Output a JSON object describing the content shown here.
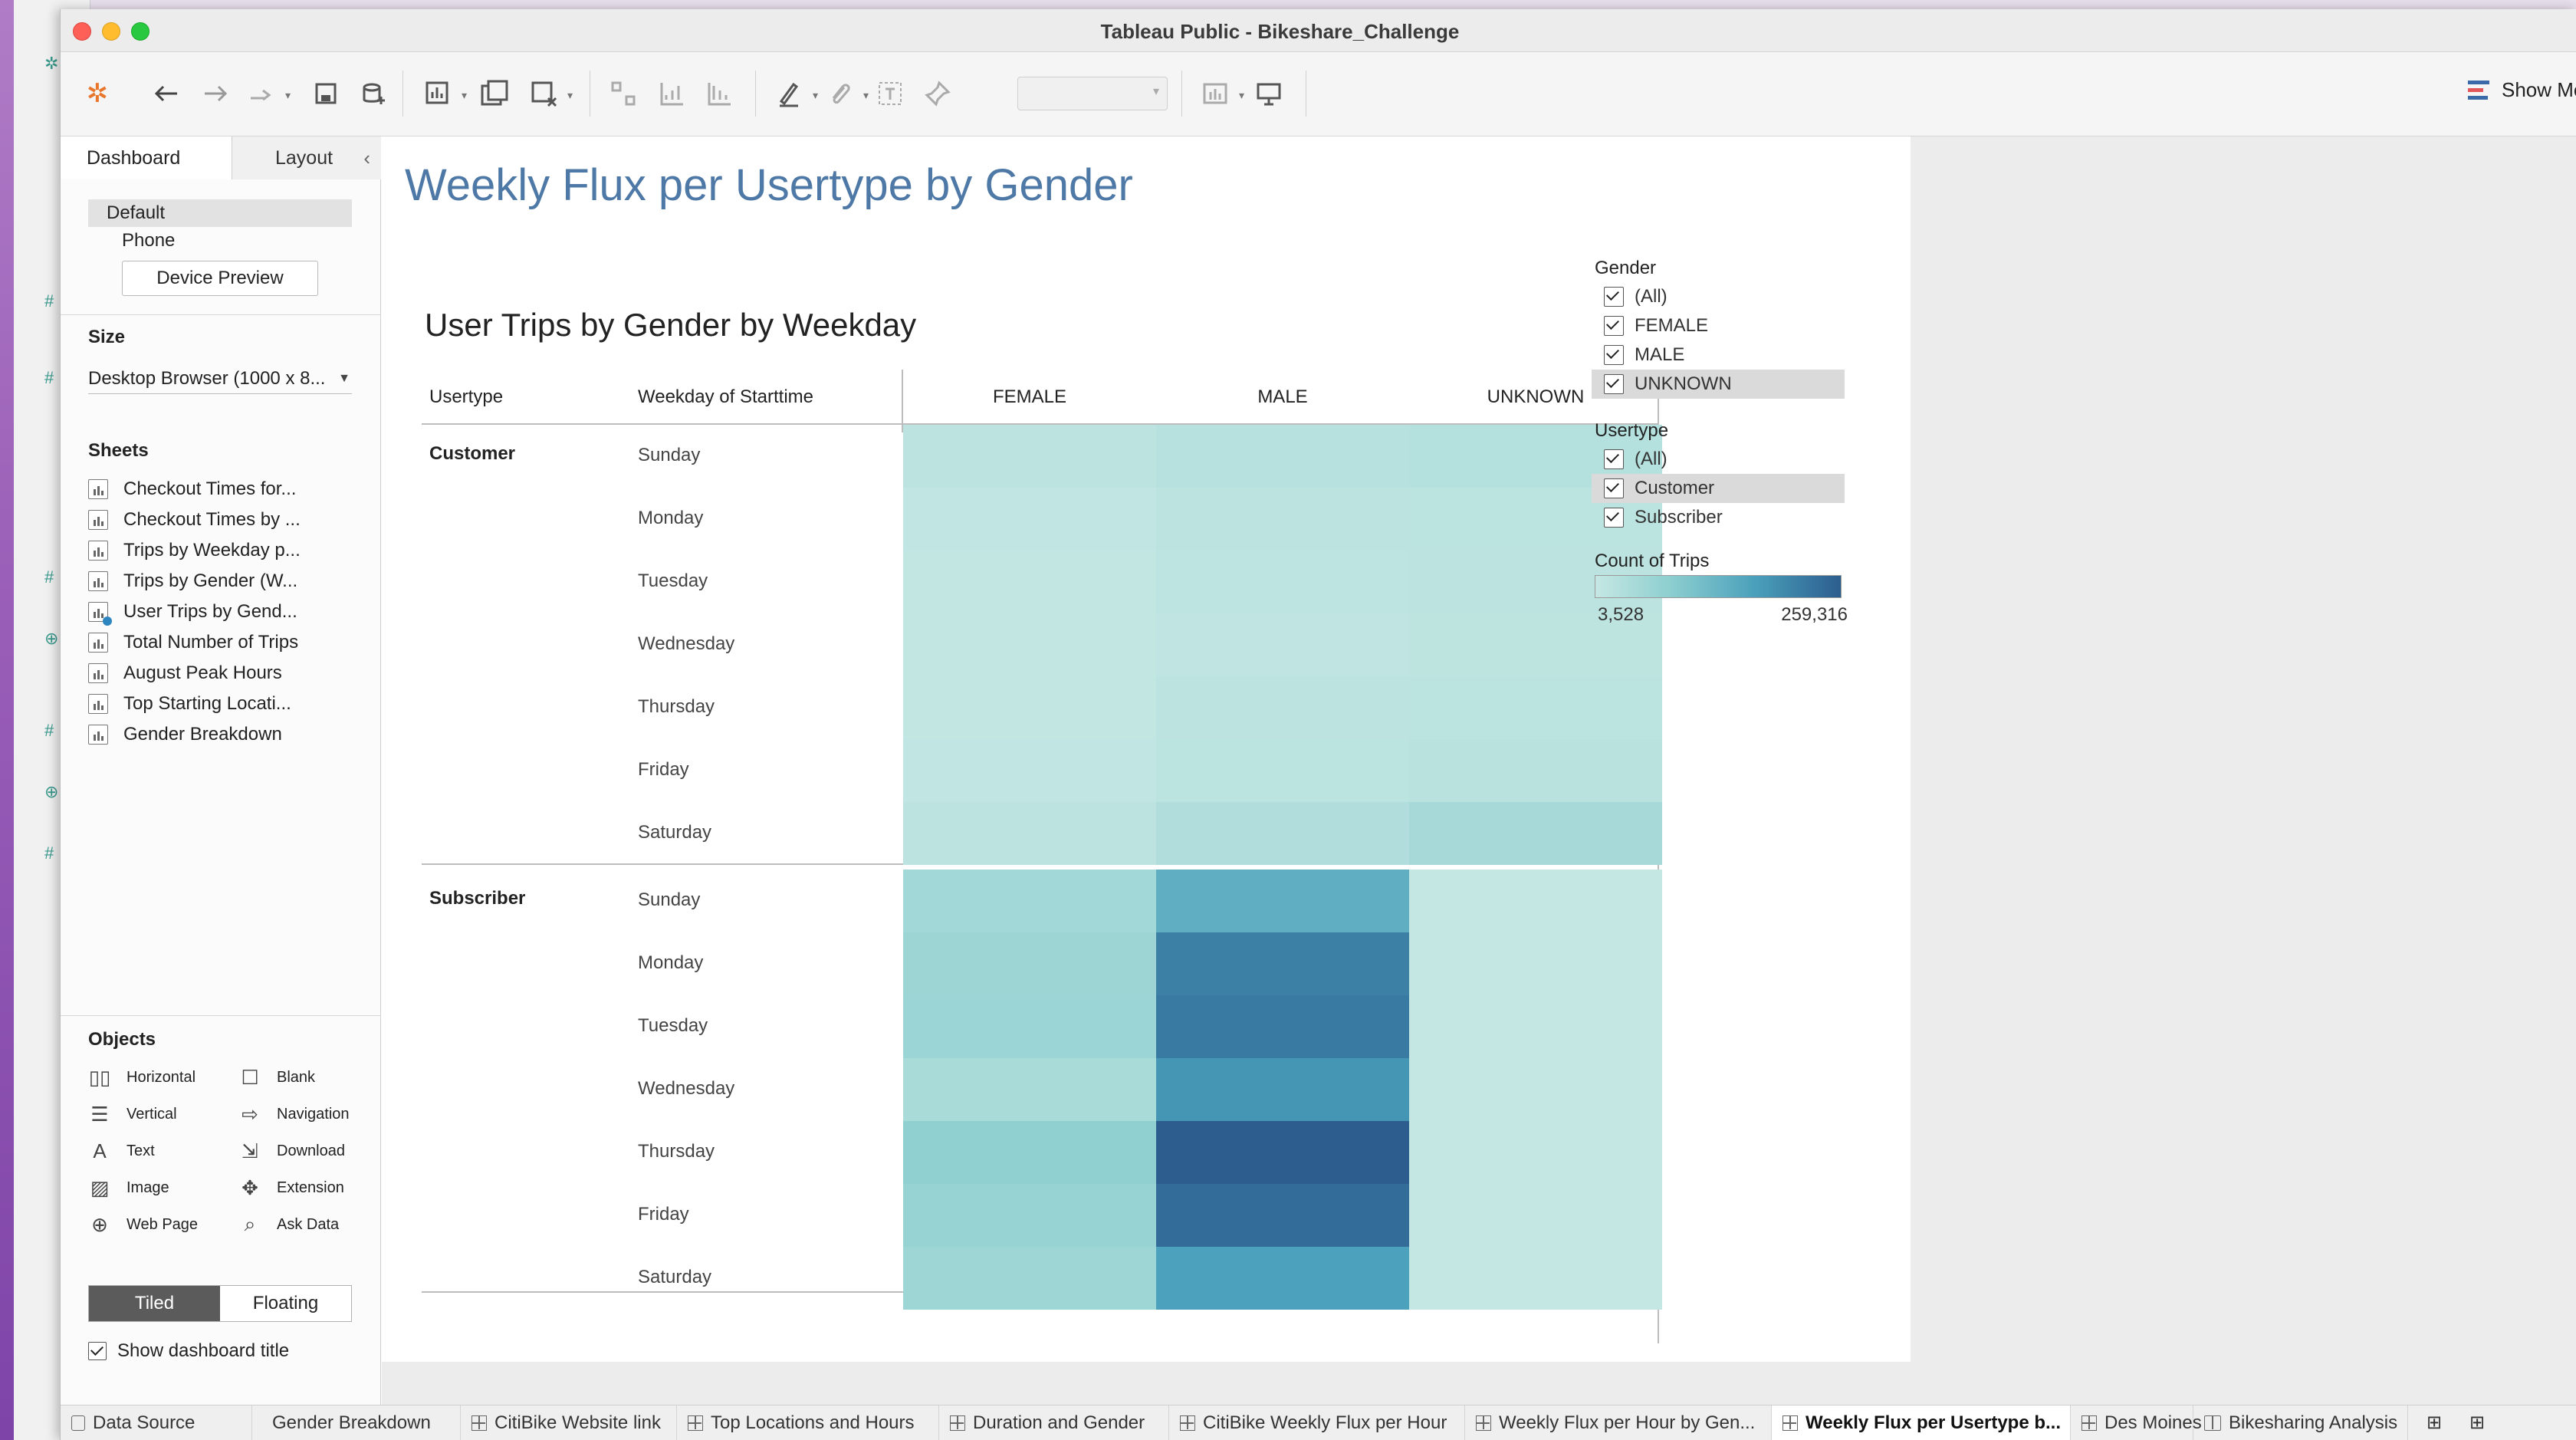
{
  "window": {
    "title": "Tableau Public - Bikeshare_Challenge"
  },
  "toolbar": {
    "show_me_label": "Show Me"
  },
  "side_panel": {
    "tabs": [
      "Dashboard",
      "Layout"
    ],
    "device_items": [
      "Default",
      "Phone"
    ],
    "device_preview_label": "Device Preview",
    "size_title": "Size",
    "size_value": "Desktop Browser (1000 x 8...",
    "sheets_title": "Sheets",
    "sheets": [
      "Checkout Times for...",
      "Checkout Times by ...",
      "Trips by Weekday p...",
      "Trips by Gender (W...",
      "User Trips by Gend...",
      "Total Number of Trips",
      "August Peak Hours",
      "Top Starting Locati...",
      "Gender Breakdown"
    ],
    "objects_title": "Objects",
    "objects": [
      {
        "label": "Horizontal",
        "icon": "horizontal-icon"
      },
      {
        "label": "Blank",
        "icon": "blank-icon"
      },
      {
        "label": "Vertical",
        "icon": "vertical-icon"
      },
      {
        "label": "Navigation",
        "icon": "navigation-icon"
      },
      {
        "label": "Text",
        "icon": "text-icon"
      },
      {
        "label": "Download",
        "icon": "download-icon"
      },
      {
        "label": "Image",
        "icon": "image-icon"
      },
      {
        "label": "Extension",
        "icon": "extension-icon"
      },
      {
        "label": "Web Page",
        "icon": "web-page-icon"
      },
      {
        "label": "Ask Data",
        "icon": "ask-data-icon"
      }
    ],
    "tiled_label": "Tiled",
    "floating_label": "Floating",
    "show_title_label": "Show dashboard title"
  },
  "dashboard": {
    "title": "Weekly Flux per Usertype by Gender",
    "sheet_title": "User Trips by Gender by Weekday",
    "col_headers": {
      "usertype": "Usertype",
      "weekday": "Weekday of Starttime"
    },
    "filters": {
      "gender": {
        "title": "Gender",
        "items": [
          "(All)",
          "FEMALE",
          "MALE",
          "UNKNOWN"
        ],
        "highlighted": "UNKNOWN"
      },
      "usertype": {
        "title": "Usertype",
        "items": [
          "(All)",
          "Customer",
          "Subscriber"
        ],
        "highlighted": "Customer"
      }
    },
    "color_legend": {
      "title": "Count of Trips",
      "min_label": "3,528",
      "max_label": "259,316",
      "colors": [
        "#c5e7e3",
        "#8ecfd0",
        "#4aa0bb",
        "#2c5d8e"
      ]
    }
  },
  "chart_data": {
    "type": "heatmap",
    "title": "User Trips by Gender by Weekday",
    "columns": [
      "FEMALE",
      "MALE",
      "UNKNOWN"
    ],
    "row_groups": [
      {
        "name": "Customer",
        "rows": [
          "Sunday",
          "Monday",
          "Tuesday",
          "Wednesday",
          "Thursday",
          "Friday",
          "Saturday"
        ]
      },
      {
        "name": "Subscriber",
        "rows": [
          "Sunday",
          "Monday",
          "Tuesday",
          "Wednesday",
          "Thursday",
          "Friday",
          "Saturday"
        ]
      }
    ],
    "values": [
      [
        18000,
        26000,
        30000
      ],
      [
        9000,
        16000,
        19000
      ],
      [
        8000,
        14000,
        17000
      ],
      [
        7500,
        13000,
        15000
      ],
      [
        8500,
        16000,
        19000
      ],
      [
        9500,
        19000,
        22000
      ],
      [
        16000,
        34000,
        52000
      ],
      [
        58000,
        148000,
        4000
      ],
      [
        66000,
        215000,
        3600
      ],
      [
        68000,
        222000,
        3528
      ],
      [
        47000,
        188000,
        3600
      ],
      [
        85000,
        259316,
        3800
      ],
      [
        74000,
        240000,
        3700
      ],
      [
        64000,
        172000,
        4200
      ]
    ],
    "color_scale": {
      "min": 3528,
      "max": 259316,
      "label": "Count of Trips"
    }
  },
  "bottom_tabs": [
    {
      "label": "Data Source",
      "kind": "datasource"
    },
    {
      "label": "Gender Breakdown",
      "kind": "sheet"
    },
    {
      "label": "CitiBike Website link",
      "kind": "grid"
    },
    {
      "label": "Top Locations and Hours",
      "kind": "grid"
    },
    {
      "label": "Duration and Gender",
      "kind": "grid"
    },
    {
      "label": "CitiBike Weekly Flux per Hour",
      "kind": "grid"
    },
    {
      "label": "Weekly Flux per Hour by Gen...",
      "kind": "grid"
    },
    {
      "label": "Weekly Flux per Usertype b...",
      "kind": "grid",
      "active": true
    },
    {
      "label": "Des Moines",
      "kind": "grid"
    },
    {
      "label": "Bikesharing Analysis",
      "kind": "story"
    }
  ]
}
